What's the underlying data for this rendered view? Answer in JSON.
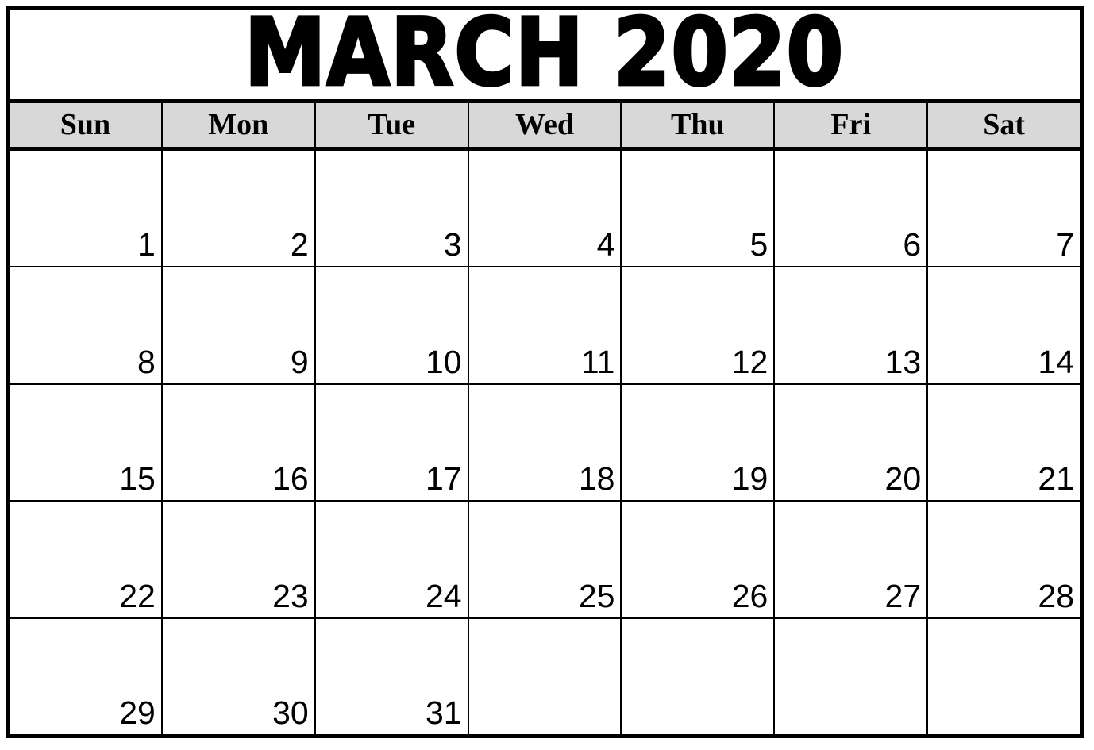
{
  "document": {
    "type": "monthly-calendar",
    "title": "MARCH 2020",
    "month": "MARCH",
    "year": "2020"
  },
  "colors": {
    "border": "#000000",
    "header_background": "#d8d8d8",
    "cell_background": "#ffffff",
    "text": "#000000",
    "page_background": "#ffffff"
  },
  "weekdays": [
    {
      "label": "Sun"
    },
    {
      "label": "Mon"
    },
    {
      "label": "Tue"
    },
    {
      "label": "Wed"
    },
    {
      "label": "Thu"
    },
    {
      "label": "Fri"
    },
    {
      "label": "Sat"
    }
  ],
  "weeks": [
    {
      "days": [
        {
          "number": "1"
        },
        {
          "number": "2"
        },
        {
          "number": "3"
        },
        {
          "number": "4"
        },
        {
          "number": "5"
        },
        {
          "number": "6"
        },
        {
          "number": "7"
        }
      ]
    },
    {
      "days": [
        {
          "number": "8"
        },
        {
          "number": "9"
        },
        {
          "number": "10"
        },
        {
          "number": "11"
        },
        {
          "number": "12"
        },
        {
          "number": "13"
        },
        {
          "number": "14"
        }
      ]
    },
    {
      "days": [
        {
          "number": "15"
        },
        {
          "number": "16"
        },
        {
          "number": "17"
        },
        {
          "number": "18"
        },
        {
          "number": "19"
        },
        {
          "number": "20"
        },
        {
          "number": "21"
        }
      ]
    },
    {
      "days": [
        {
          "number": "22"
        },
        {
          "number": "23"
        },
        {
          "number": "24"
        },
        {
          "number": "25"
        },
        {
          "number": "26"
        },
        {
          "number": "27"
        },
        {
          "number": "28"
        }
      ]
    },
    {
      "days": [
        {
          "number": "29"
        },
        {
          "number": "30"
        },
        {
          "number": "31"
        },
        {
          "number": ""
        },
        {
          "number": ""
        },
        {
          "number": ""
        },
        {
          "number": ""
        }
      ]
    }
  ]
}
